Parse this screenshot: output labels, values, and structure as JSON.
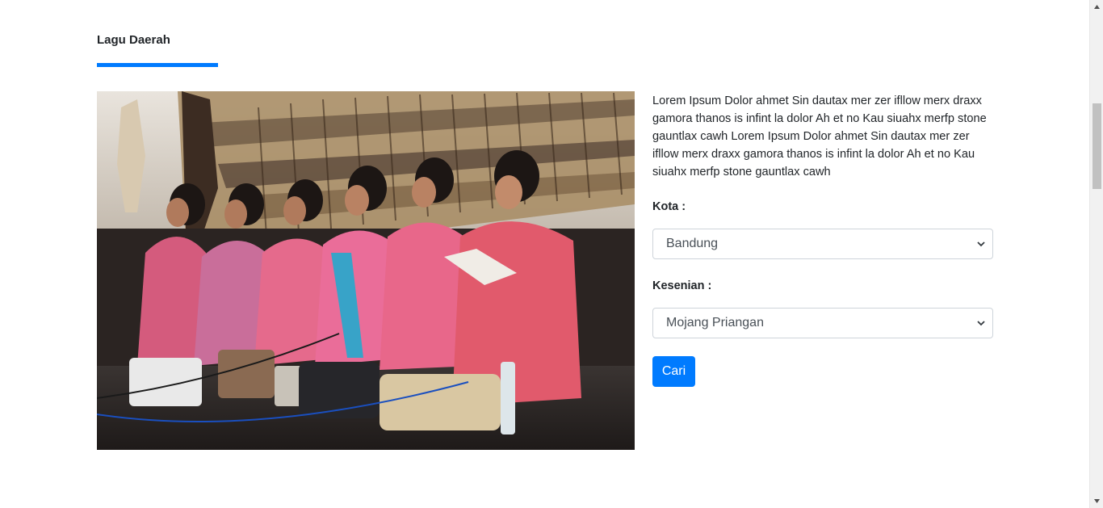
{
  "section": {
    "title": "Lagu Daerah"
  },
  "content": {
    "description": "Lorem Ipsum Dolor ahmet Sin dautax mer zer ifllow merx draxx gamora thanos is infint la dolor Ah et no Kau siuahx merfp stone gauntlax cawh Lorem Ipsum Dolor ahmet Sin dautax mer zer ifllow merx draxx gamora thanos is infint la dolor Ah et no Kau siuahx merfp stone gauntlax cawh"
  },
  "form": {
    "kota_label": "Kota :",
    "kota_value": "Bandung",
    "kesenian_label": "Kesenian :",
    "kesenian_value": "Mojang Priangan",
    "submit_label": "Cari"
  },
  "colors": {
    "accent": "#007bff",
    "text": "#212529"
  },
  "icons": {
    "select_arrow": "chevron-down-icon",
    "scroll_up": "triangle-up-icon",
    "scroll_down": "triangle-down-icon"
  }
}
